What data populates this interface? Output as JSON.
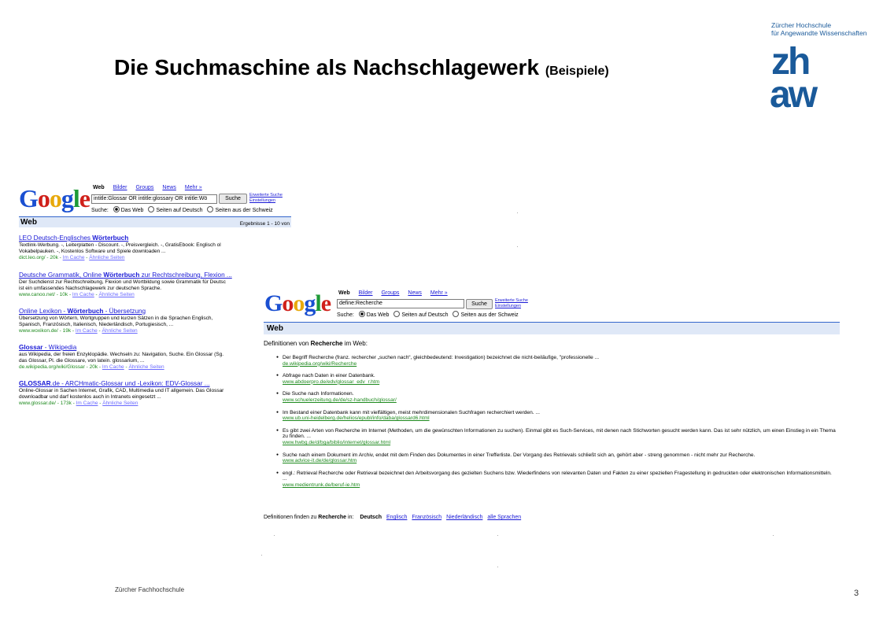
{
  "slide": {
    "title": "Die Suchmaschine als Nachschlagewerk",
    "title_suffix": "(Beispiele)",
    "logo_line1": "Zürcher Hochschule",
    "logo_line2": "für Angewandte Wissenschaften",
    "logo_mark_top": "zh",
    "logo_mark_bottom": "aw",
    "footer": "Zürcher  Fachhochschule",
    "page_number": "3"
  },
  "colors": {
    "link": "#1a1ad6",
    "url_green": "#1e8a1e",
    "web_bar": "#dfe8f7",
    "zhaw_blue": "#1a5a9a"
  },
  "google_logo": {
    "G": "G",
    "o1": "o",
    "o2": "o",
    "g": "g",
    "l": "l",
    "e": "e"
  },
  "shot1": {
    "tabs": [
      "Web",
      "Bilder",
      "Groups",
      "News",
      "Mehr »"
    ],
    "query": "intitle:Glossar OR intitle:glossary OR intitle:Wö",
    "search_button": "Suche",
    "advanced": "Erweiterte Suche",
    "settings": "Einstellungen",
    "search_label": "Suche:",
    "radio_options": [
      "Das Web",
      "Seiten auf Deutsch",
      "Seiten aus der Schweiz"
    ],
    "web_label": "Web",
    "results_count": "Ergebnisse 1 - 10 von",
    "results": [
      {
        "title_pre": "LEO Deutsch-Englisches ",
        "title_bold": "Wörterbuch",
        "title_post": "",
        "snippet1": "Textlink-Werbung. -, Leiterplatten - Discount. -, Preisvergleich. -, GratisEbook: Englisch ol",
        "snippet2": "Vokabelpauken. -, Kostenlos Software und Spiele downloaden ...",
        "url": "dict.leo.org/ - 20k - ",
        "cache": "Im Cache",
        "sep": " - ",
        "similar": "Ähnliche Seiten"
      },
      {
        "title_pre": "Deutsche Grammatik, Online ",
        "title_bold": "Wörterbuch",
        "title_post": " zur Rechtschreibung, Flexion ...",
        "snippet1": "Der Suchdienst zur Rechtschreibung, Flexion und Wortbildung sowie Grammatik für Deutsc",
        "snippet2": "ist ein umfassendes Nachschlagewerk zur deutschen Sprache.",
        "url": "www.canoo.net/ - 10k - ",
        "cache": "Im Cache",
        "sep": " - ",
        "similar": "Ähnliche Seiten"
      },
      {
        "title_pre": "Online Lexikon - ",
        "title_bold": "Wörterbuch",
        "title_post": " - Übersetzung",
        "snippet1": "Übersetzung von Wörtern, Wortgruppen und kurzen Sätzen in die Sprachen Englisch,",
        "snippet2": "Spanisch, Französisch, Italienisch, Niederländisch, Portugiesisch, ...",
        "url": "www.woxikon.de/ - 19k - ",
        "cache": "Im Cache",
        "sep": " - ",
        "similar": "Ähnliche Seiten"
      },
      {
        "title_pre": "",
        "title_bold": "Glossar",
        "title_post": " - Wikipedia",
        "snippet1": "aus Wikipedia, der freien Enzyklopädie. Wechseln zu: Navigation, Suche. Ein Glossar (Sg.",
        "snippet2": "das Glossar, Pl. die Glossare, von latein. glossarium, ...",
        "url": "de.wikipedia.org/wiki/Glossar - 20k - ",
        "cache": "Im Cache",
        "sep": " - ",
        "similar": "Ähnliche Seiten"
      },
      {
        "title_pre": "",
        "title_bold": "GLOSSAR",
        "title_post": ".de - ARCHmatic-Glossar und -Lexikon: EDV-Glossar ...",
        "snippet1": "Online-Glossar in Sachen Internet, Grafik, CAD, Multimedia und IT allgemein. Das Glossar",
        "snippet2": "downloadbar und darf kostenlos auch in Intranets eingesetzt ...",
        "url": "www.glossar.de/ - 173k - ",
        "cache": "Im Cache",
        "sep": " - ",
        "similar": "Ähnliche Seiten"
      }
    ]
  },
  "shot2": {
    "tabs": [
      "Web",
      "Bilder",
      "Groups",
      "News",
      "Mehr »"
    ],
    "query": "define:Recherche",
    "search_button": "Suche",
    "advanced": "Erweiterte Suche",
    "settings": "Einstellungen",
    "search_label": "Suche:",
    "radio_options": [
      "Das Web",
      "Seiten auf Deutsch",
      "Seiten aus der Schweiz"
    ],
    "web_label": "Web",
    "definitions_label_pre": "Definitionen von ",
    "definitions_label_bold": "Recherche",
    "definitions_label_post": " im Web:",
    "definitions": [
      {
        "text": "Der Begriff Recherche (franz. rechercher „suchen nach“, gleichbedeutend: Investigation) bezeichnet die nicht-beiläufige, \"professionelle ...",
        "url": "de.wikipedia.org/wiki/Recherche"
      },
      {
        "text": "Abfrage nach Daten in einer Datenbank.",
        "url": "www.abdoerpro.de/edv/glossar_edv_r.htm"
      },
      {
        "text": "Die Suche nach Informationen.",
        "url": "www.schuelerzeitung.de/de/sz-handbuch/glossar/"
      },
      {
        "text": "Im Bestand einer Datenbank kann mit vielfältigen, meist mehrdimensionalen Suchfragen recherchiert werden. ...",
        "url": "www.ub.uni-heidelberg.de/helios/epubl/info/daba/glossard6.html"
      },
      {
        "text": "Es gibt zwei Arten von Recherche im Internet (Methoden, um die gewünschten Informationen zu suchen). Einmal gibt es Such-Services, mit denen nach Stichworten gesucht werden kann. Das ist sehr nützlich, um einen Einstieg in ein Thema zu finden. ...",
        "url": "www.hwbg.de/d/bga/biblio/internet/glossar.html"
      },
      {
        "text": "Suche nach einem Dokument im Archiv, endet mit dem Finden des Dokumentes in einer Trefferliste. Der Vorgang des Retrievals schließt sich an, gehört aber - streng genommen - nicht mehr zur Recherche.",
        "url": "www.advice-it.de/de/glossar.htm"
      },
      {
        "text": "engl.: Retrieval Recherche oder Retrieval bezeichnet den Arbeitsvorgang des gezielten Suchens bzw. Wiederfindens von relevanten Daten und Fakten zu einer speziellen Fragestellung in gedruckten oder elektronischen Informationsmitteln. ...",
        "url": "www.medientrunk.de/beruf-ie.htm"
      }
    ],
    "lang_line_pre": "Definitionen finden zu ",
    "lang_line_bold": "Recherche",
    "lang_line_post": " in:",
    "lang_current": "Deutsch",
    "languages": [
      "Englisch",
      "Französisch",
      "Niederländisch",
      "alle Sprachen"
    ]
  }
}
